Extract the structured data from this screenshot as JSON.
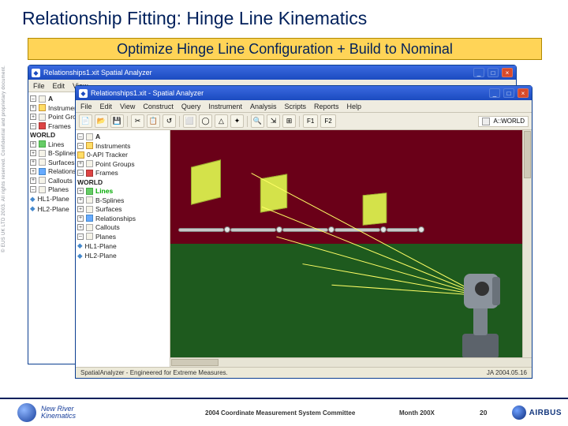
{
  "title": "Relationship Fitting: Hinge Line Kinematics",
  "banner": "Optimize Hinge Line Configuration + Build to Nominal",
  "side_text": "© EUS UK LTD 2003. All rights reserved. Confidential and proprietary document.",
  "window_back": {
    "title": "Relationships1.xit  Spatial Analyzer",
    "menu": [
      "File",
      "Edit",
      "View"
    ],
    "tree": {
      "root": "A",
      "items": [
        "Instruments",
        "Point Groups",
        "Frames",
        "WORLD",
        "Lines",
        "B-Splines",
        "Surfaces",
        "Relationships",
        "Callouts",
        "Planes",
        "HL1-Plane",
        "HL2-Plane"
      ]
    }
  },
  "window_front": {
    "title": "Relationships1.xit - Spatial Analyzer",
    "menu": [
      "File",
      "Edit",
      "View",
      "Construct",
      "Query",
      "Instrument",
      "Analysis",
      "Scripts",
      "Reports",
      "Help"
    ],
    "toolbar_labels": [
      "F1",
      "F2"
    ],
    "coord_label": "A::WORLD",
    "tree": {
      "root": "A",
      "items": [
        {
          "l": "Instruments",
          "i": 1
        },
        {
          "l": "0-API Tracker",
          "i": 2,
          "c": "yel"
        },
        {
          "l": "Point Groups",
          "i": 1
        },
        {
          "l": "Frames",
          "i": 1,
          "c": "red"
        },
        {
          "l": "WORLD",
          "i": 2,
          "bold": true
        },
        {
          "l": "Lines",
          "i": 1,
          "c": "grn",
          "bold": true
        },
        {
          "l": "B-Splines",
          "i": 1
        },
        {
          "l": "Surfaces",
          "i": 1
        },
        {
          "l": "Relationships",
          "i": 1,
          "c": "blu"
        },
        {
          "l": "Callouts",
          "i": 1
        },
        {
          "l": "Planes",
          "i": 1
        },
        {
          "l": "HL1-Plane",
          "i": 2
        },
        {
          "l": "HL2-Plane",
          "i": 2
        }
      ]
    },
    "status_left": "SpatialAnalyzer - Engineered for Extreme Measures.",
    "status_right": "JA 2004.05.16"
  },
  "footer": {
    "nrk1": "New River",
    "nrk2": "Kinematics",
    "committee": "2004 Coordinate Measurement System Committee",
    "date": "Month 200X",
    "page": "20",
    "airbus": "AIRBUS"
  }
}
